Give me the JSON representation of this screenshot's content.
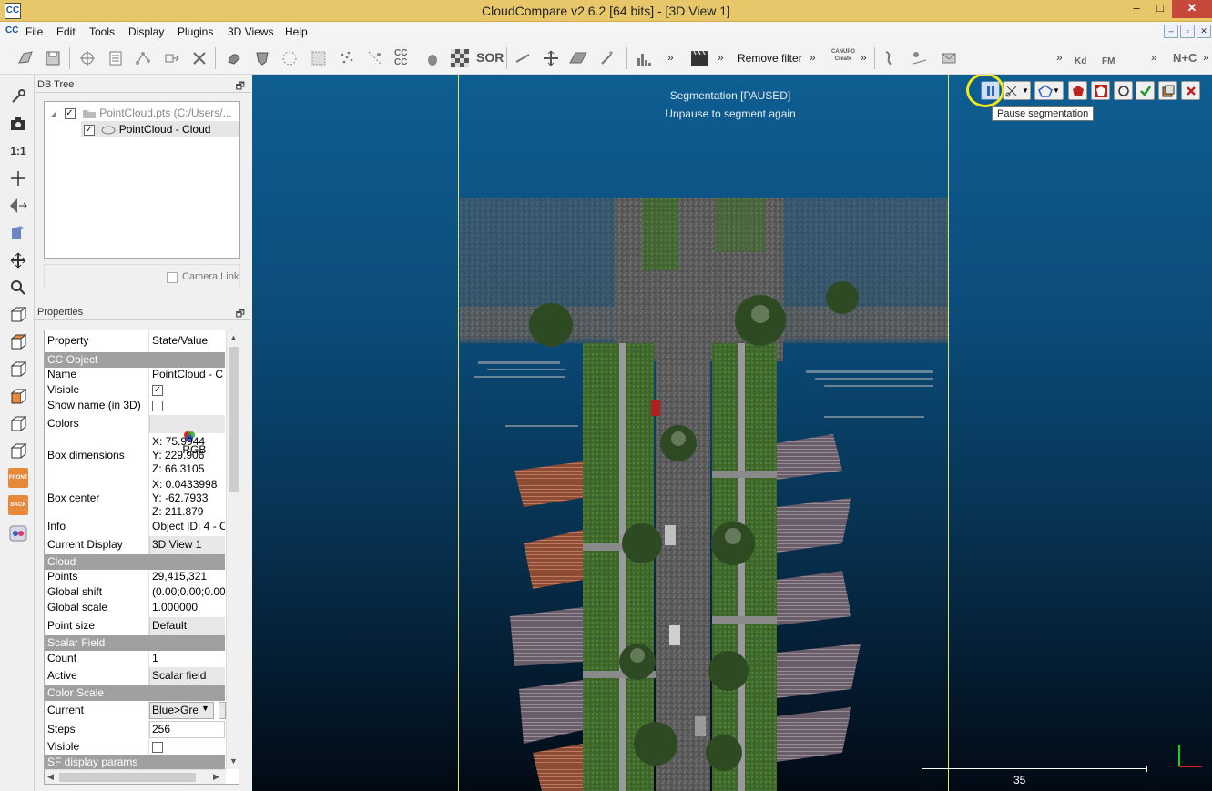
{
  "app": {
    "icon_label": "CC",
    "title": "CloudCompare v2.6.2 [64 bits] - [3D View 1]"
  },
  "window_controls": {
    "minimize": "–",
    "maximize": "□",
    "close": "✕"
  },
  "menu": {
    "items": [
      "File",
      "Edit",
      "Tools",
      "Display",
      "Plugins",
      "3D Views",
      "Help"
    ],
    "mdi_controls": [
      "–",
      "▫",
      "✕"
    ]
  },
  "toolbar": {
    "remove_filter": "Remove filter",
    "more": "»",
    "cc_label": "CC\nCC",
    "sor_label": "SOR",
    "canupo_label": "CANUPO\nCreate",
    "kd_label": "Kd",
    "fm_label": "FM",
    "nc_label": "N+C"
  },
  "lefttool": {
    "one_to_one": "1:1",
    "front": "FRONT",
    "back": "BACK"
  },
  "db_tree": {
    "title": "DB Tree",
    "float_icon": "🗗",
    "root": {
      "label": "PointCloud.pts (C:/Users/...",
      "checked": true
    },
    "child": {
      "label": "PointCloud - Cloud",
      "checked": true
    },
    "camera_link": "Camera Link"
  },
  "properties": {
    "title": "Properties",
    "header": {
      "key": "Property",
      "value": "State/Value"
    },
    "cc_object": {
      "section": "CC Object",
      "name_k": "Name",
      "name_v": "PointCloud - C",
      "visible_k": "Visible",
      "visible_v": "✓",
      "showname_k": "Show name (in 3D)",
      "showname_v": "",
      "colors_k": "Colors",
      "colors_v": "RGB",
      "boxdim_k": "Box dimensions",
      "boxdim_x": "X: 75.9944",
      "boxdim_y": "Y: 229.906",
      "boxdim_z": "Z: 66.3105",
      "boxcenter_k": "Box center",
      "boxcenter_x": "X: 0.0433998",
      "boxcenter_y": "Y: -62.7933",
      "boxcenter_z": "Z: 211.879",
      "info_k": "Info",
      "info_v": "Object ID: 4 - C",
      "display_k": "Current Display",
      "display_v": "3D View 1"
    },
    "cloud": {
      "section": "Cloud",
      "points_k": "Points",
      "points_v": "29,415,321",
      "shift_k": "Global shift",
      "shift_v": "(0.00;0.00;0.00)",
      "scale_k": "Global scale",
      "scale_v": "1.000000",
      "psize_k": "Point size",
      "psize_v": "Default"
    },
    "scalar_field": {
      "section": "Scalar Field",
      "count_k": "Count",
      "count_v": "1",
      "active_k": "Active",
      "active_v": "Scalar field"
    },
    "color_scale": {
      "section": "Color Scale",
      "current_k": "Current",
      "current_v": "Blue>Gre",
      "steps_k": "Steps",
      "steps_v": "256",
      "visible_k": "Visible",
      "visible_v": ""
    },
    "sf_display": {
      "section": "SF display params"
    }
  },
  "view": {
    "status_line1": "Segmentation [PAUSED]",
    "status_line2": "Unpause to segment again",
    "tooltip": "Pause segmentation",
    "scale_label": "35",
    "seg_tool_icons": [
      "pause-icon",
      "scissors-icon",
      "polygon-icon",
      "segment-in-icon",
      "segment-out-icon",
      "reset-icon",
      "confirm-icon",
      "export-icon",
      "cancel-icon"
    ],
    "colors": {
      "highlight": "#f4ea1a",
      "segment_border": "#e4e45a",
      "confirm": "#1f9a1f",
      "cancel": "#c02020"
    }
  }
}
